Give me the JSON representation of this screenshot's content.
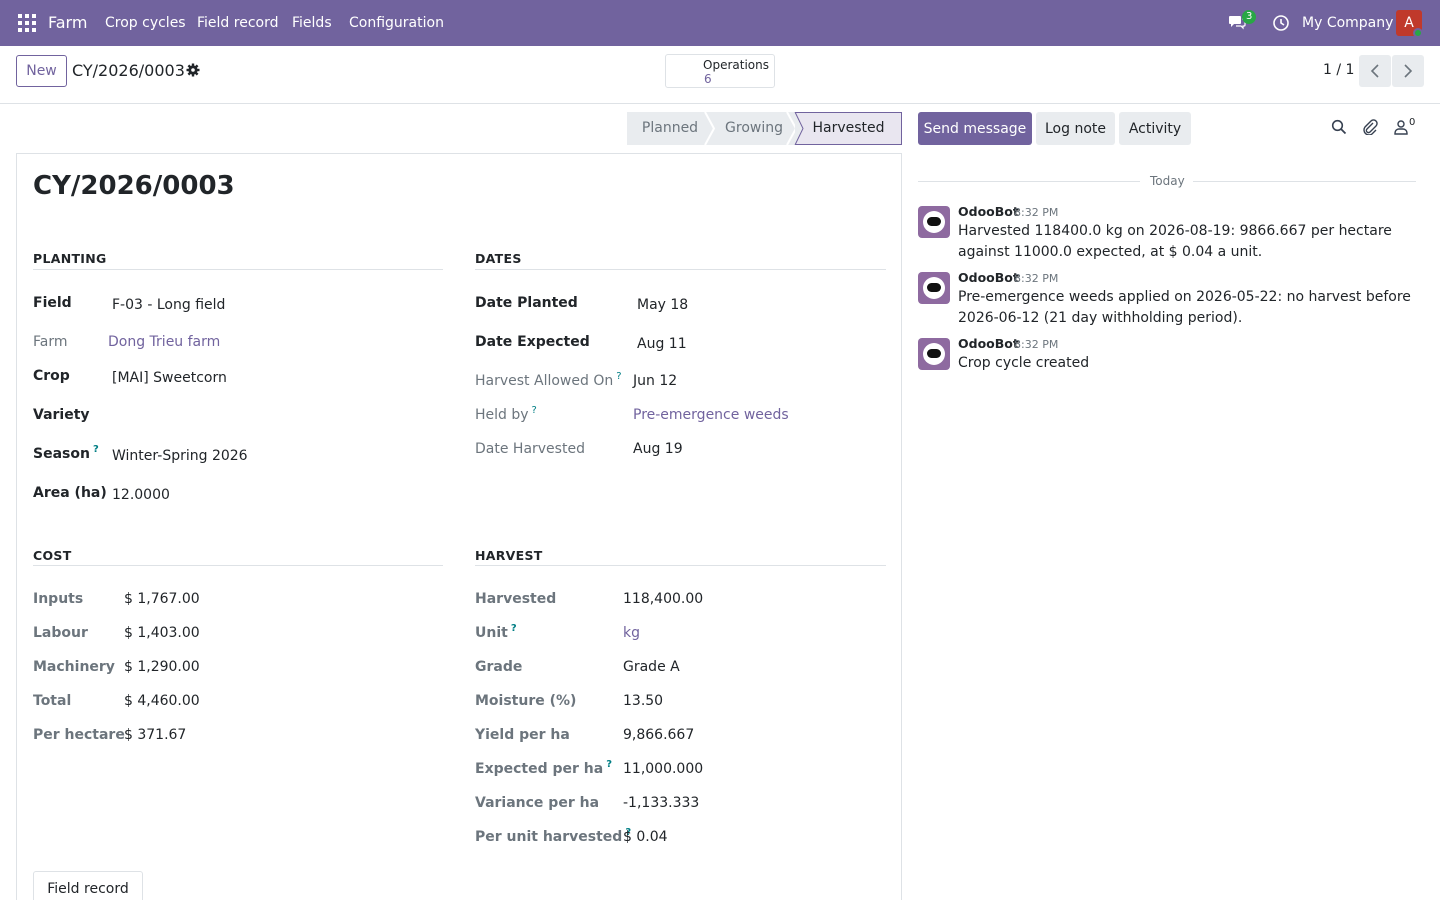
{
  "navbar": {
    "brand": "Farm",
    "menu": [
      "Crop cycles",
      "Field record",
      "Fields",
      "Configuration"
    ],
    "messages_count": "3",
    "company": "My Company",
    "avatar_letter": "A"
  },
  "control": {
    "new_label": "New",
    "record_name": "CY/2026/0003",
    "smart_label": "Operations",
    "smart_value": "6",
    "pager": "1 / 1"
  },
  "status": {
    "stages": [
      "Planned",
      "Growing",
      "Harvested"
    ],
    "active": "Harvested"
  },
  "form": {
    "title": "CY/2026/0003",
    "planting": {
      "title": "PLANTING",
      "field_label": "Field",
      "field_value": "F-03 - Long field",
      "farm_label": "Farm",
      "farm_value": "Dong Trieu farm",
      "crop_label": "Crop",
      "crop_value": "[MAI] Sweetcorn",
      "variety_label": "Variety",
      "season_label": "Season",
      "season_value": "Winter-Spring 2026",
      "area_label": "Area (ha)",
      "area_value": "12.0000"
    },
    "dates": {
      "title": "DATES",
      "planted_label": "Date Planted",
      "planted_value": "May 18",
      "expected_label": "Date Expected",
      "expected_value": "Aug 11",
      "allowed_label": "Harvest Allowed On",
      "allowed_value": "Jun 12",
      "held_label": "Held by",
      "held_value": "Pre-emergence weeds",
      "harvested_label": "Date Harvested",
      "harvested_value": "Aug 19"
    },
    "cost": {
      "title": "COST",
      "rows": [
        {
          "label": "Inputs",
          "value": "$ 1,767.00"
        },
        {
          "label": "Labour",
          "value": "$ 1,403.00"
        },
        {
          "label": "Machinery",
          "value": "$ 1,290.00"
        },
        {
          "label": "Total",
          "value": "$ 4,460.00"
        },
        {
          "label": "Per hectare",
          "value": "$ 371.67"
        }
      ]
    },
    "harvest": {
      "title": "HARVEST",
      "rows": [
        {
          "label": "Harvested",
          "value": "118,400.00"
        },
        {
          "label": "Unit",
          "value": "kg"
        },
        {
          "label": "Grade",
          "value": "Grade A"
        },
        {
          "label": "Moisture (%)",
          "value": "13.50"
        },
        {
          "label": "Yield per ha",
          "value": "9,866.667"
        },
        {
          "label": "Expected per ha",
          "value": "11,000.000"
        },
        {
          "label": "Variance per ha",
          "value": "-1,133.333"
        },
        {
          "label": "Per unit harvested",
          "value": "$ 0.04"
        }
      ]
    },
    "field_record_button": "Field record"
  },
  "chatter": {
    "send_message": "Send message",
    "log_note": "Log note",
    "activity": "Activity",
    "followers": "0",
    "today": "Today",
    "messages": [
      {
        "author": "OdooBot",
        "time": "8:32 PM",
        "body": "Harvested 118400.0 kg on 2026-08-19: 9866.667 per hectare against 11000.0 expected, at $ 0.04 a unit."
      },
      {
        "author": "OdooBot",
        "time": "8:32 PM",
        "body": "Pre-emergence weeds applied on 2026-05-22: no harvest before 2026-06-12 (21 day withholding period)."
      },
      {
        "author": "OdooBot",
        "time": "8:32 PM",
        "body": "Crop cycle created"
      }
    ]
  },
  "colors": {
    "brand": "#71639e",
    "link": "#71639e",
    "help": "#017e84",
    "online": "#28a745"
  }
}
